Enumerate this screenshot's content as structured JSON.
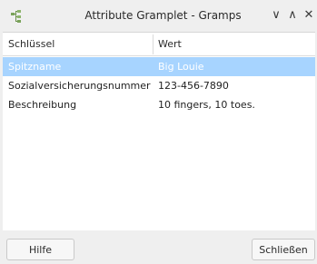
{
  "window": {
    "title": "Attribute Gramplet - Gramps",
    "controls": {
      "minimize": "∨",
      "maximize": "∧",
      "close": "✕"
    }
  },
  "table": {
    "columns": [
      "Schlüssel",
      "Wert"
    ],
    "rows": [
      {
        "key": "Spitzname",
        "value": "Big Louie",
        "selected": true
      },
      {
        "key": "Sozialversicherungsnummer",
        "value": "123-456-7890",
        "selected": false
      },
      {
        "key": "Beschreibung",
        "value": "10 fingers, 10 toes.",
        "selected": false
      }
    ]
  },
  "buttons": {
    "help": "Hilfe",
    "close": "Schließen"
  },
  "colors": {
    "selection": "#a7d4ff",
    "background": "#efefef"
  }
}
